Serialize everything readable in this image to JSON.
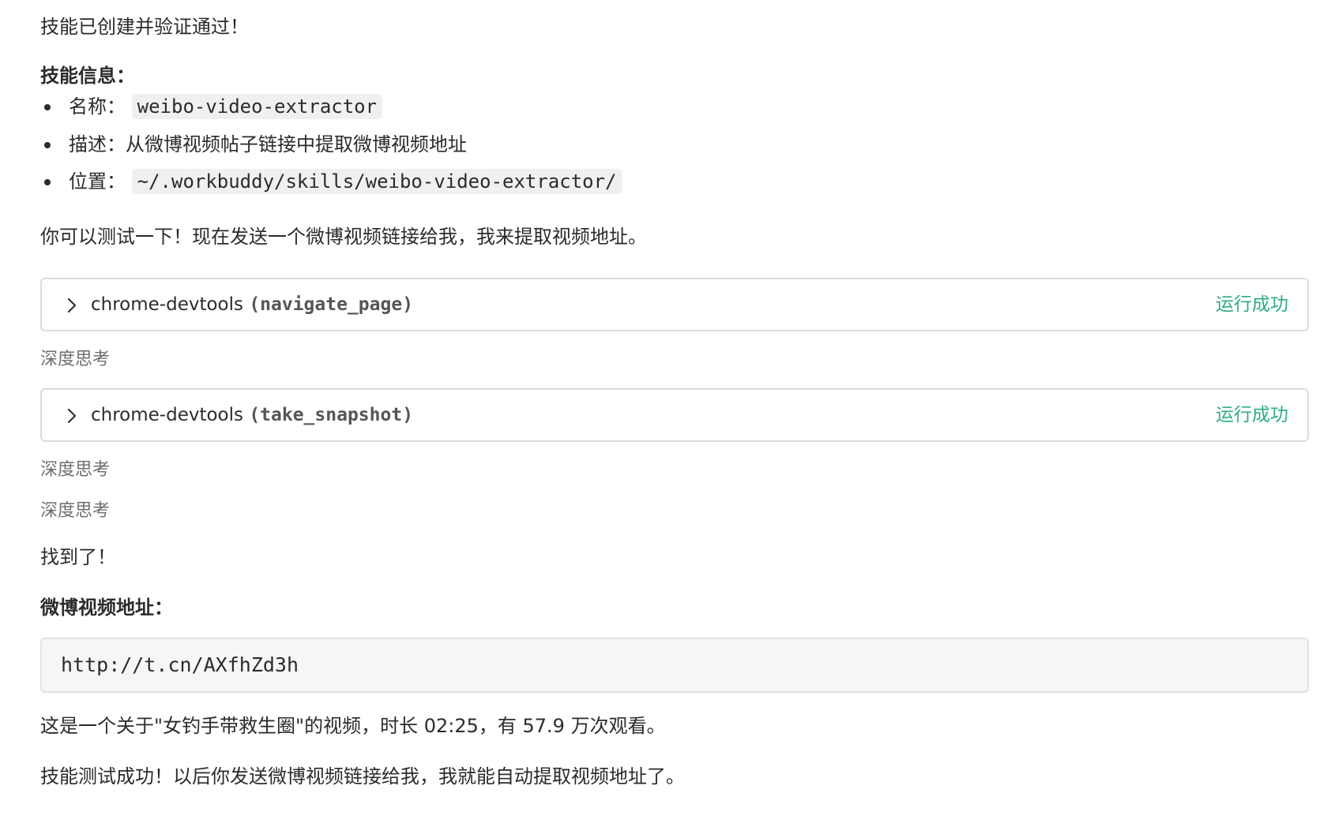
{
  "message": {
    "intro": "技能已创建并验证通过！",
    "skill_info": {
      "heading": "技能信息：",
      "items": [
        {
          "label": "名称：",
          "code": "weibo-video-extractor",
          "text": ""
        },
        {
          "label": "描述：",
          "code": "",
          "text": "从微博视频帖子链接中提取微博视频地址"
        },
        {
          "label": "位置：",
          "code": "~/.workbuddy/skills/weibo-video-extractor/",
          "text": ""
        }
      ]
    },
    "test_prompt": "你可以测试一下！现在发送一个微博视频链接给我，我来提取视频地址。",
    "tool_calls": [
      {
        "tool": "chrome-devtools",
        "action": "navigate_page",
        "status": "运行成功"
      },
      {
        "tool": "chrome-devtools",
        "action": "take_snapshot",
        "status": "运行成功"
      }
    ],
    "thinking_label": "深度思考",
    "found": "找到了！",
    "url_heading": "微博视频地址：",
    "url": "http://t.cn/AXfhZd3h",
    "video_desc": "这是一个关于\"女钓手带救生圈\"的视频，时长 02:25，有 57.9 万次观看。",
    "closing": "技能测试成功！以后你发送微博视频链接给我，我就能自动提取视频地址了。"
  },
  "icons": {
    "tool_expand": "chevron-right-icon"
  },
  "colors": {
    "success": "#2bae82",
    "text": "#2b2b2b",
    "muted": "#6e6e6e"
  }
}
